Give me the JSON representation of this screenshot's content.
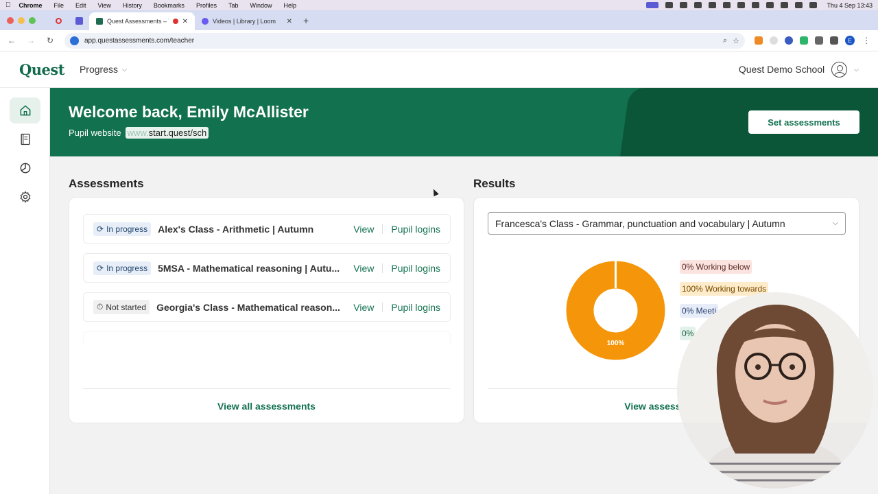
{
  "macos": {
    "app": "Chrome",
    "menus": [
      "File",
      "Edit",
      "View",
      "History",
      "Bookmarks",
      "Profiles",
      "Tab",
      "Window",
      "Help"
    ],
    "clock": "Thu 4 Sep  13:43"
  },
  "browser": {
    "tabs": [
      {
        "title": "Quest Assessments – The",
        "active": true
      },
      {
        "title": "Videos | Library | Loom",
        "active": false
      }
    ],
    "url": "app.questassessments.com/teacher",
    "profile_initial": "E"
  },
  "header": {
    "logo": "Quest",
    "nav_label": "Progress",
    "school": "Quest Demo School"
  },
  "sidebar": {
    "items": [
      "home-icon",
      "book-icon",
      "chart-pie-icon",
      "gear-icon"
    ]
  },
  "hero": {
    "welcome": "Welcome back, Emily McAllister",
    "pupil_label": "Pupil website",
    "pupil_url_prefix": "www.",
    "pupil_url_rest": "start.quest/sch",
    "cta": "Set assessments"
  },
  "assessments": {
    "title": "Assessments",
    "rows": [
      {
        "status": "In progress",
        "name": "Alex's Class - Arithmetic | Autumn",
        "view": "View",
        "logins": "Pupil logins"
      },
      {
        "status": "In progress",
        "name": "5MSA - Mathematical reasoning | Autu...",
        "view": "View",
        "logins": "Pupil logins"
      },
      {
        "status": "Not started",
        "name": "Georgia's Class - Mathematical reason...",
        "view": "View",
        "logins": "Pupil logins"
      }
    ],
    "view_all": "View all assessments"
  },
  "results": {
    "title": "Results",
    "selected_class": "Francesca's Class - Grammar, punctuation and vocabulary | Autumn",
    "donut_label": "100%",
    "legend": {
      "below": "0% Working below",
      "towards": "100% Working towards",
      "meeting": "0% Meeti",
      "greater": "0%"
    },
    "view_link": "View assessme",
    "colors": {
      "towards": "#f5960a",
      "accent": "#12714f"
    }
  }
}
